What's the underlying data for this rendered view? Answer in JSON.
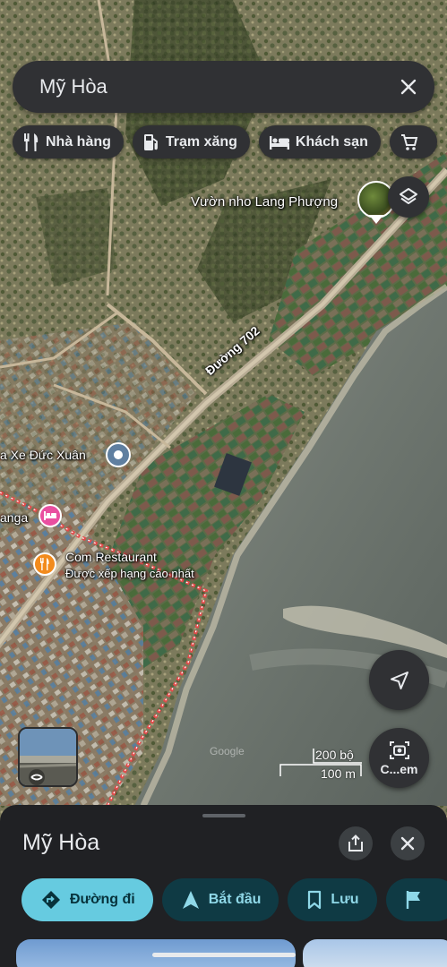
{
  "search": {
    "query": "Mỹ Hòa"
  },
  "chips": [
    {
      "label": "Nhà hàng",
      "icon": "restaurant-icon"
    },
    {
      "label": "Trạm xăng",
      "icon": "gas-station-icon"
    },
    {
      "label": "Khách sạn",
      "icon": "hotel-icon"
    },
    {
      "label": "",
      "icon": "shopping-cart-icon"
    }
  ],
  "map": {
    "labels": {
      "vineyard": "Vườn nho Lang Phượng",
      "road": "Đường 702",
      "garage": "a Xe Đức Xuân",
      "lodging": "anga",
      "restaurant_name": "Com Restaurant",
      "restaurant_note": "Được xếp hạng cao nhất"
    },
    "scale": {
      "imperial": "200 bộ",
      "metric": "100 m"
    },
    "watermark": "Google",
    "lens_label": "C...em"
  },
  "place": {
    "title": "Mỹ Hòa",
    "actions": [
      {
        "label": "Đường đi",
        "icon": "directions-icon"
      },
      {
        "label": "Bắt đầu",
        "icon": "navigation-arrow-icon"
      },
      {
        "label": "Lưu",
        "icon": "bookmark-icon"
      },
      {
        "label": "",
        "icon": "flag-icon"
      }
    ]
  },
  "colors": {
    "surface": "#303134",
    "sheet": "#202124",
    "accent": "#66cbe0",
    "hotel_pin": "#e94fa0",
    "restaurant_pin": "#f28b1d",
    "poi_pin": "#5f7fa0",
    "boundary": "#e24b4b"
  }
}
